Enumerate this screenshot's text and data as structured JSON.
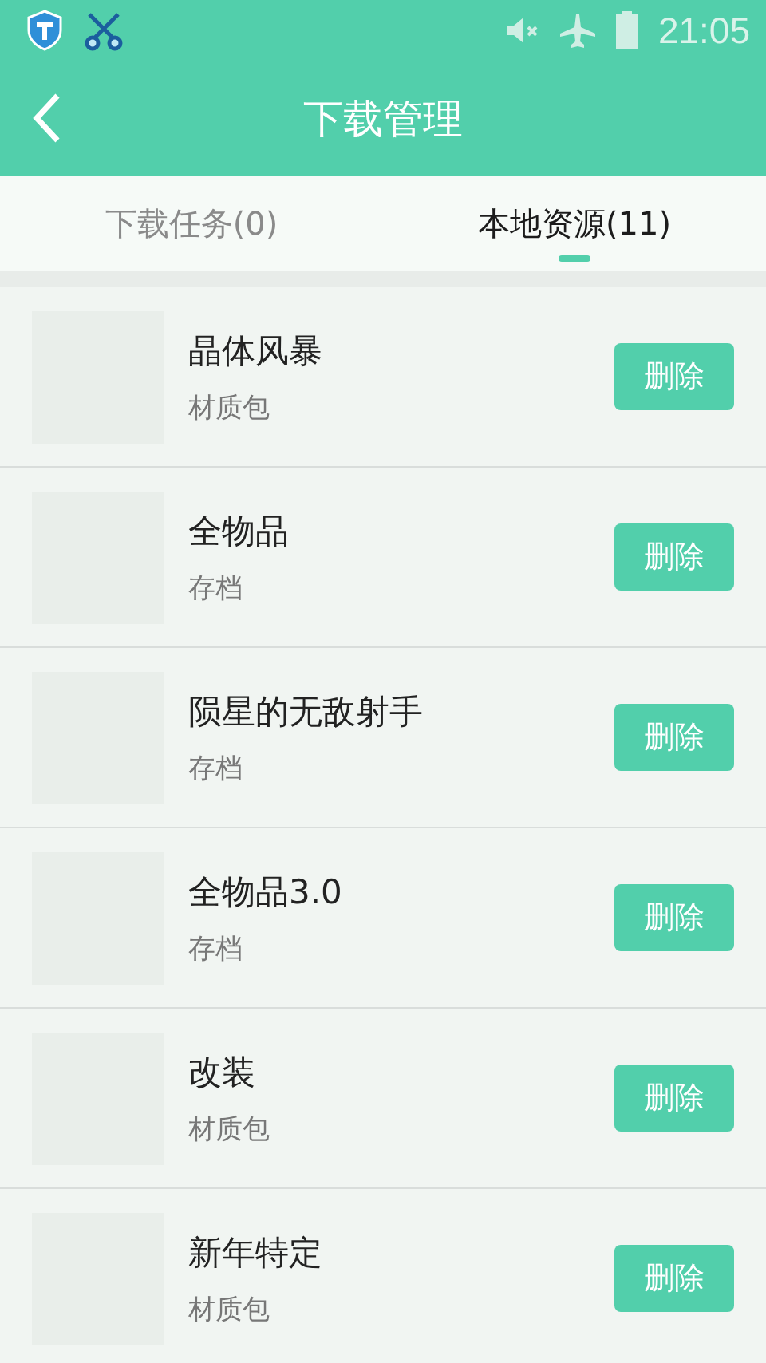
{
  "status_bar": {
    "time": "21:05"
  },
  "toolbar": {
    "title": "下载管理"
  },
  "tabs": [
    {
      "label": "下载任务(0)",
      "selected": false
    },
    {
      "label": "本地资源(11)",
      "selected": true
    }
  ],
  "items": [
    {
      "name": "晶体风暴",
      "type": "材质包",
      "button": "删除"
    },
    {
      "name": "全物品",
      "type": "存档",
      "button": "删除"
    },
    {
      "name": "陨星的无敌射手",
      "type": "存档",
      "button": "删除"
    },
    {
      "name": "全物品3.0",
      "type": "存档",
      "button": "删除"
    },
    {
      "name": "改装",
      "type": "材质包",
      "button": "删除"
    },
    {
      "name": "新年特定",
      "type": "材质包",
      "button": "删除"
    }
  ]
}
